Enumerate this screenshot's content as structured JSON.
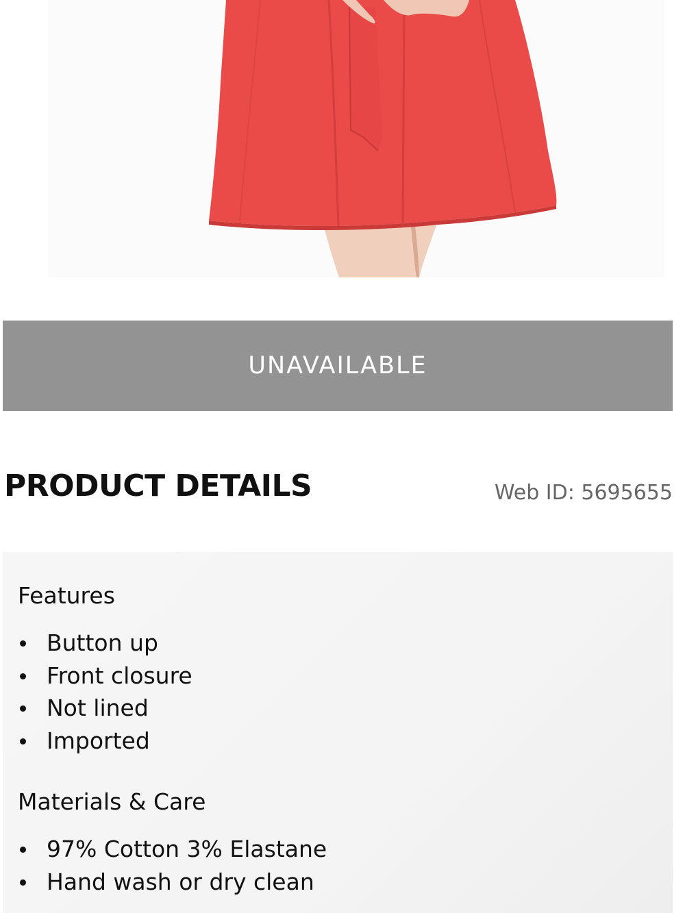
{
  "product_image": {
    "alt": "red-skirt-product-photo",
    "skirt_color": "#ea4a48"
  },
  "purchase": {
    "button_label": "UNAVAILABLE",
    "button_color": "#939393"
  },
  "details": {
    "title": "PRODUCT DETAILS",
    "web_id": "Web ID: 5695655",
    "sections": [
      {
        "heading": "Features",
        "items": [
          "Button up",
          "Front closure",
          "Not lined",
          "Imported"
        ]
      },
      {
        "heading": "Materials & Care",
        "items": [
          "97% Cotton 3% Elastane",
          "Hand wash or dry clean"
        ]
      }
    ]
  }
}
